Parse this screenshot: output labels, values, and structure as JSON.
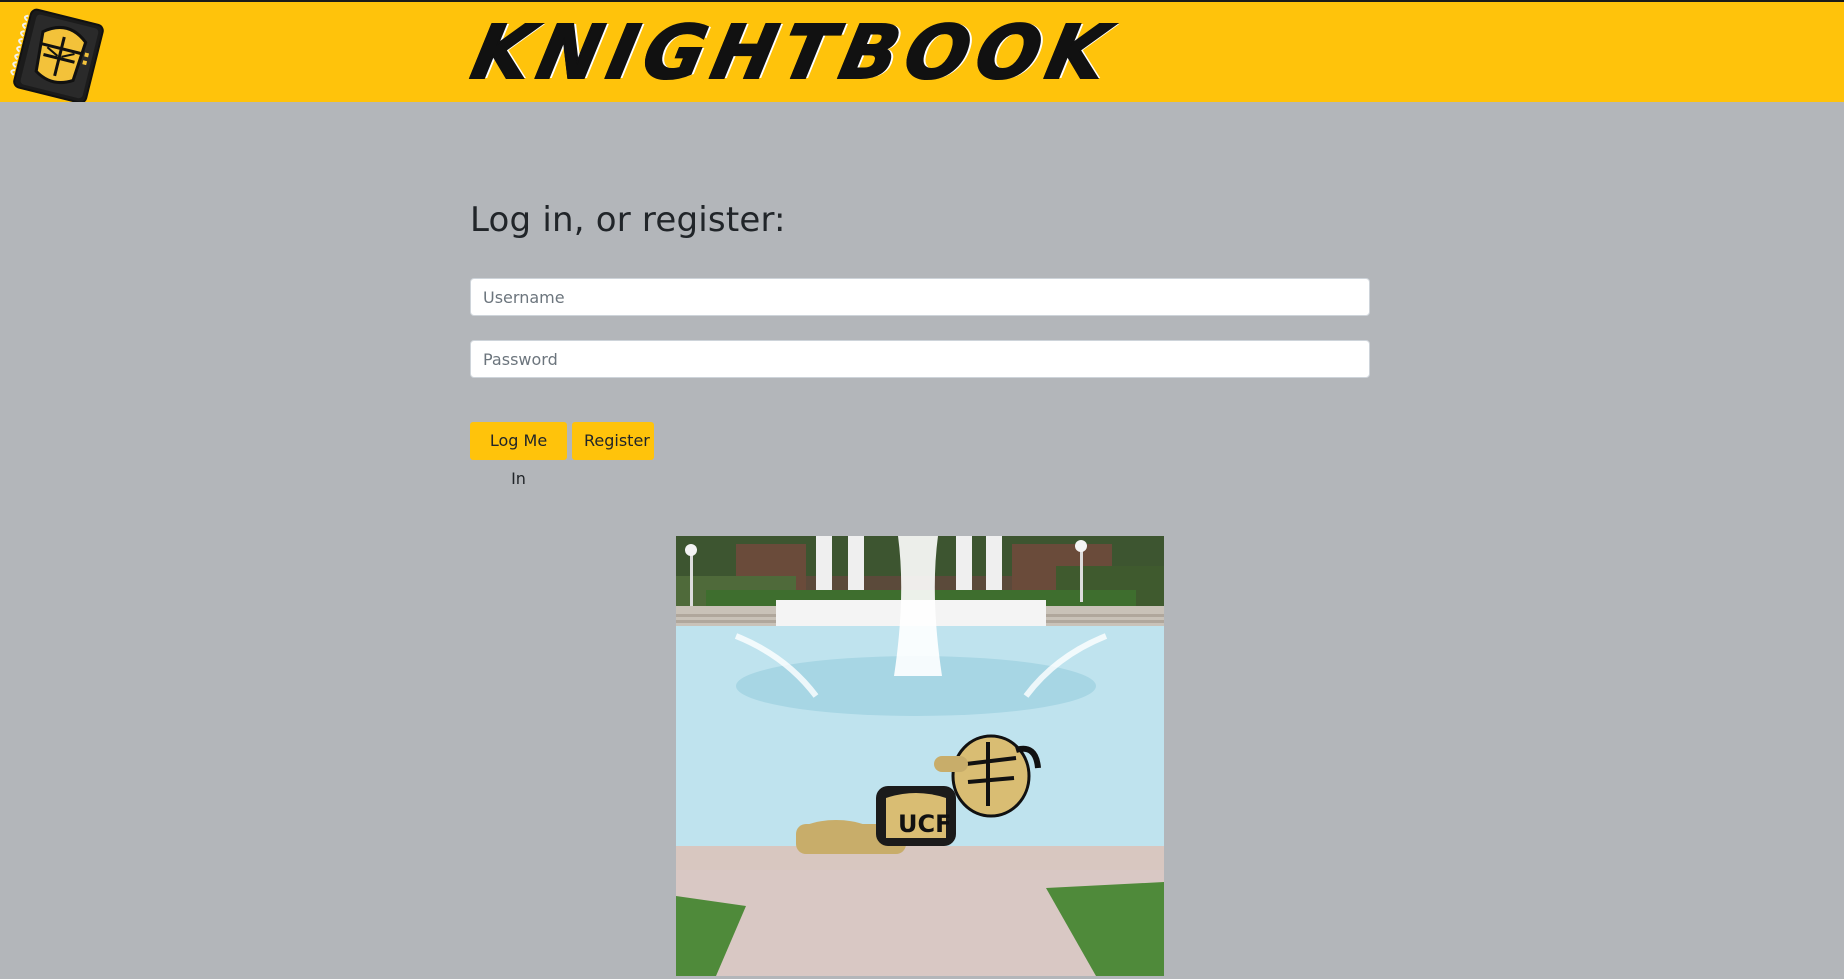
{
  "header": {
    "logo_icon": "knight-helmet-notebook-icon",
    "brand_name": "KNIGHTBOOK",
    "accent_color": "#ffc30b"
  },
  "login": {
    "title": "Log in, or register:",
    "username_placeholder": "Username",
    "username_value": "",
    "password_placeholder": "Password",
    "password_value": "",
    "login_button_label": "Log Me In",
    "register_button_label": "Register"
  },
  "photo": {
    "description_icon": "mascot-fountain-photo"
  },
  "colors": {
    "page_background": "#b3b6ba",
    "button_background": "#ffc30b",
    "header_background": "#ffc30b"
  }
}
